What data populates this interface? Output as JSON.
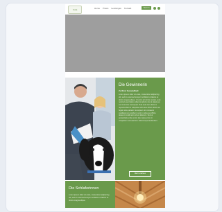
{
  "nav": {
    "logo_text": "Cura",
    "menu": [
      "Home",
      "Praxis",
      "Leistungen",
      "Kontakt"
    ],
    "cta_label": "Termin"
  },
  "about": {
    "title": "Die Gewinnerin",
    "subtitle": "Zu Ihrer Gesundheit",
    "text": "Lorem ipsum dolor sit amet, consectetur adipiscing elit, sed do eiusmod tempor incididunt ut labore et dolore magna aliqua. Ut enim ad minim veniam, quis nostrud exercitation ullamco laboris nisi ut aliquip ex ea commodo consequat. Duis aute irure dolor in reprehenderit in voluptate velit esse cillum dolore eu fugiat nulla pariatur. Excepteur sint occaecat cupidatat non proident, sunt in culpa qui officia deserunt mollit anim id est laborum. Sed ut perspiciatis unde omnis iste natus error sit voluptatem accusantium doloremque laudantium.",
    "button_label": "Mehr erfahren"
  },
  "bottom": {
    "title": "Die Schlaferinnen",
    "text": "Lorem ipsum dolor sit amet, consectetur adipiscing elit, sed do eiusmod tempor incididunt ut labore et dolore magna aliqua."
  },
  "colors": {
    "accent": "#6a9a4b",
    "placeholder": "#9e9e9e"
  }
}
